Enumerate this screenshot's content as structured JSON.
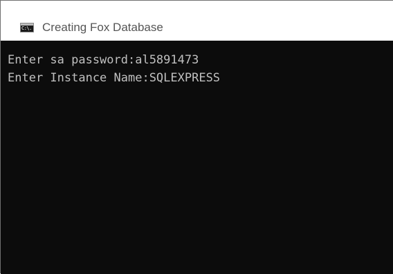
{
  "window": {
    "title": "Creating Fox Database",
    "icon": "cmd-icon",
    "icon_glyph": "C:\\."
  },
  "console": {
    "lines": [
      "Enter sa password:al5891473",
      "Enter Instance Name:SQLEXPRESS"
    ]
  },
  "colors": {
    "console_bg": "#0c0c0c",
    "console_text": "#c0c0c0",
    "titlebar_bg": "#ffffff",
    "title_text": "#555555"
  }
}
